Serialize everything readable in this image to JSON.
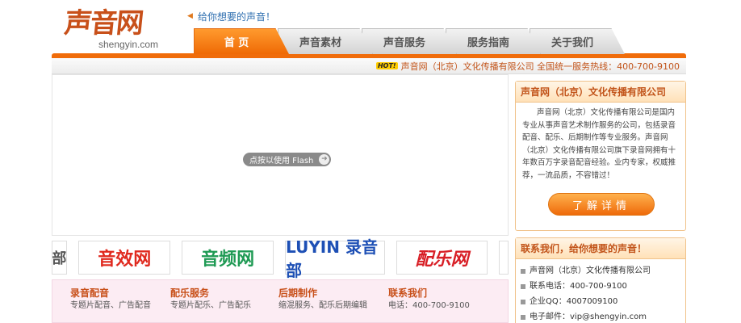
{
  "logo": {
    "mark": "声音网",
    "domain": "shengyin.com"
  },
  "slogan": "给你想要的声音！",
  "tabs": [
    {
      "label": "首 页"
    },
    {
      "label": "声音素材"
    },
    {
      "label": "声音服务"
    },
    {
      "label": "服务指南"
    },
    {
      "label": "关于我们"
    }
  ],
  "info_bar": {
    "hot": "HOT!",
    "text": "声音网（北京）文化传播有限公司 全国统一服务热线：400-700-9100"
  },
  "flash": {
    "button_label": "点按以使用 Flash",
    "arrow": "➜"
  },
  "partners": [
    "部",
    "音效网",
    "音频网",
    "LUYIN 录音部",
    "配乐网",
    ""
  ],
  "footer_cols": [
    {
      "title": "录音配音",
      "line": "专题片配音、广告配音"
    },
    {
      "title": "配乐服务",
      "line": "专题片配乐、广告配乐"
    },
    {
      "title": "后期制作",
      "line": "缩混服务、配乐后期编辑"
    },
    {
      "title": "联系我们",
      "line": "电话：400-700-9100"
    }
  ],
  "company_card": {
    "title": "声音网（北京）文化传播有限公司",
    "text": "声音网（北京）文化传播有限公司是国内专业从事声音艺术制作服务的公司，包括录音配音、配乐、后期制作等专业服务。声音网（北京）文化传播有限公司旗下录音网拥有十年数百万字录音配音经验。业内专家，权威推荐，一流品质，不容错过！",
    "button": "了解详情"
  },
  "contact_card": {
    "title": "联系我们，给你想要的声音！",
    "items": [
      "声音网（北京）文化传播有限公司",
      "联系电话：400-700-9100",
      "企业QQ：4007009100",
      "电子邮件：vip@shengyin.com"
    ]
  }
}
